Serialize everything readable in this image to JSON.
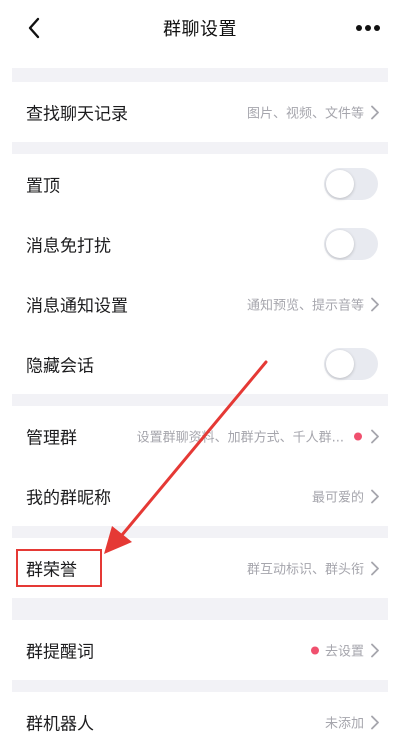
{
  "header": {
    "title": "群聊设置",
    "back_icon": "chevron-left-icon",
    "more_icon": "more-horizontal-icon"
  },
  "rows": {
    "search_history": {
      "label": "查找聊天记录",
      "hint": "图片、视频、文件等"
    },
    "pin_top": {
      "label": "置顶",
      "toggle_on": false
    },
    "do_not_disturb": {
      "label": "消息免打扰",
      "toggle_on": false
    },
    "notification_settings": {
      "label": "消息通知设置",
      "hint": "通知预览、提示音等"
    },
    "hide_session": {
      "label": "隐藏会话",
      "toggle_on": false
    },
    "manage_group": {
      "label": "管理群",
      "hint": "设置群聊资料、加群方式、千人群..."
    },
    "my_nickname": {
      "label": "我的群昵称",
      "hint": "最可爱的"
    },
    "group_honor": {
      "label": "群荣誉",
      "hint": "群互动标识、群头衔"
    },
    "reminder_words": {
      "label": "群提醒词",
      "hint": "去设置"
    },
    "group_robot": {
      "label": "群机器人",
      "hint": "未添加"
    }
  },
  "colors": {
    "accent_dot": "#f0506e",
    "annotation_red": "#e53935",
    "separator": "#f2f2f6",
    "hint_gray": "#a6a6ad"
  }
}
